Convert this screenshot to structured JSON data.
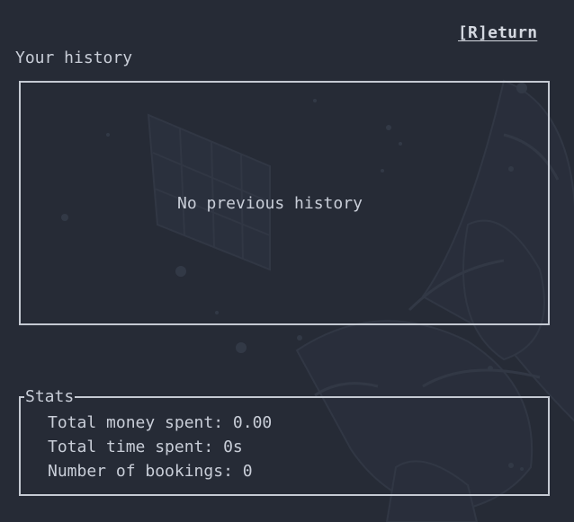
{
  "header": {
    "return_label": "[R]eturn",
    "section_title": "Your history"
  },
  "history": {
    "empty_message": "No previous history"
  },
  "stats": {
    "title": "Stats",
    "lines": [
      "Total money spent: 0.00",
      "Total time spent: 0s",
      "Number of bookings: 0"
    ]
  },
  "colors": {
    "background": "#262b36",
    "text": "#c9ced8",
    "border": "#c5cad3"
  }
}
